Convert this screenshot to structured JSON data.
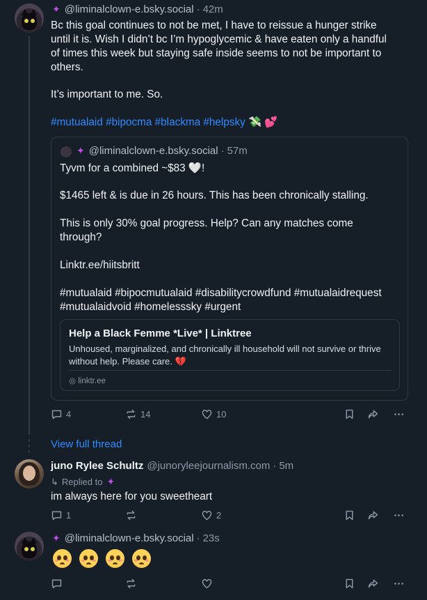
{
  "posts": [
    {
      "handle": "@liminalclown-e.bsky.social",
      "time": "42m",
      "separator": "·",
      "lines": [
        "Bc this goal continues to not be met, I have to reissue a hunger strike",
        "until it is. Wish I didn’t bc I’m hypoglycemic & have eaten only a handful",
        "of times this week but staying safe inside seems to not be important to",
        "others."
      ],
      "line2": "It’s important to me. So.",
      "tags": "#mutualaid #bipocma #blackma #helpsky",
      "tag_emoji": "💸 💕",
      "quote": {
        "handle": "@liminalclown-e.bsky.social",
        "time": "57m",
        "p1": "Tyvm for a combined ~$83 🤍!",
        "p2": "$1465 left & is due in 26 hours. This has been chronically stalling.",
        "p3a": "This is only 30% goal progress. Help? Can any matches come",
        "p3b": "through?",
        "p4": "Linktr.ee/hiitsbritt",
        "p5a": "#mutualaid #bipocmutualaid #disabilitycrowdfund #mutualaidrequest",
        "p5b": "#mutualaidvoid #homelesssky #urgent",
        "card": {
          "title": "Help a Black Femme *Live* | Linktree",
          "desc": "Unhoused, marginalized, and chronically ill household will not survive or thrive without help. Please care. 💔",
          "domain": "linktr.ee"
        }
      },
      "stats": {
        "replies": "4",
        "reposts": "14",
        "likes": "10"
      }
    },
    {
      "name": "juno Rylee Schultz",
      "handle": "@junoryleejournalism.com",
      "time": "5m",
      "replied_to": "Replied to",
      "text": "im always here for you sweetheart",
      "stats": {
        "replies": "1",
        "reposts": "",
        "likes": "2"
      }
    },
    {
      "handle": "@liminalclown-e.bsky.social",
      "time": "23s",
      "stats": {
        "replies": "",
        "reposts": "",
        "likes": ""
      }
    }
  ],
  "view_full_thread": "View full thread",
  "icons": [
    "reply-icon",
    "repost-icon",
    "like-icon",
    "bookmark-icon",
    "share-icon",
    "more-icon"
  ],
  "colors": {
    "background": "#161e27",
    "link": "#2f8bff",
    "muted": "#8d9aa8",
    "sparkle": "#c04de8"
  }
}
